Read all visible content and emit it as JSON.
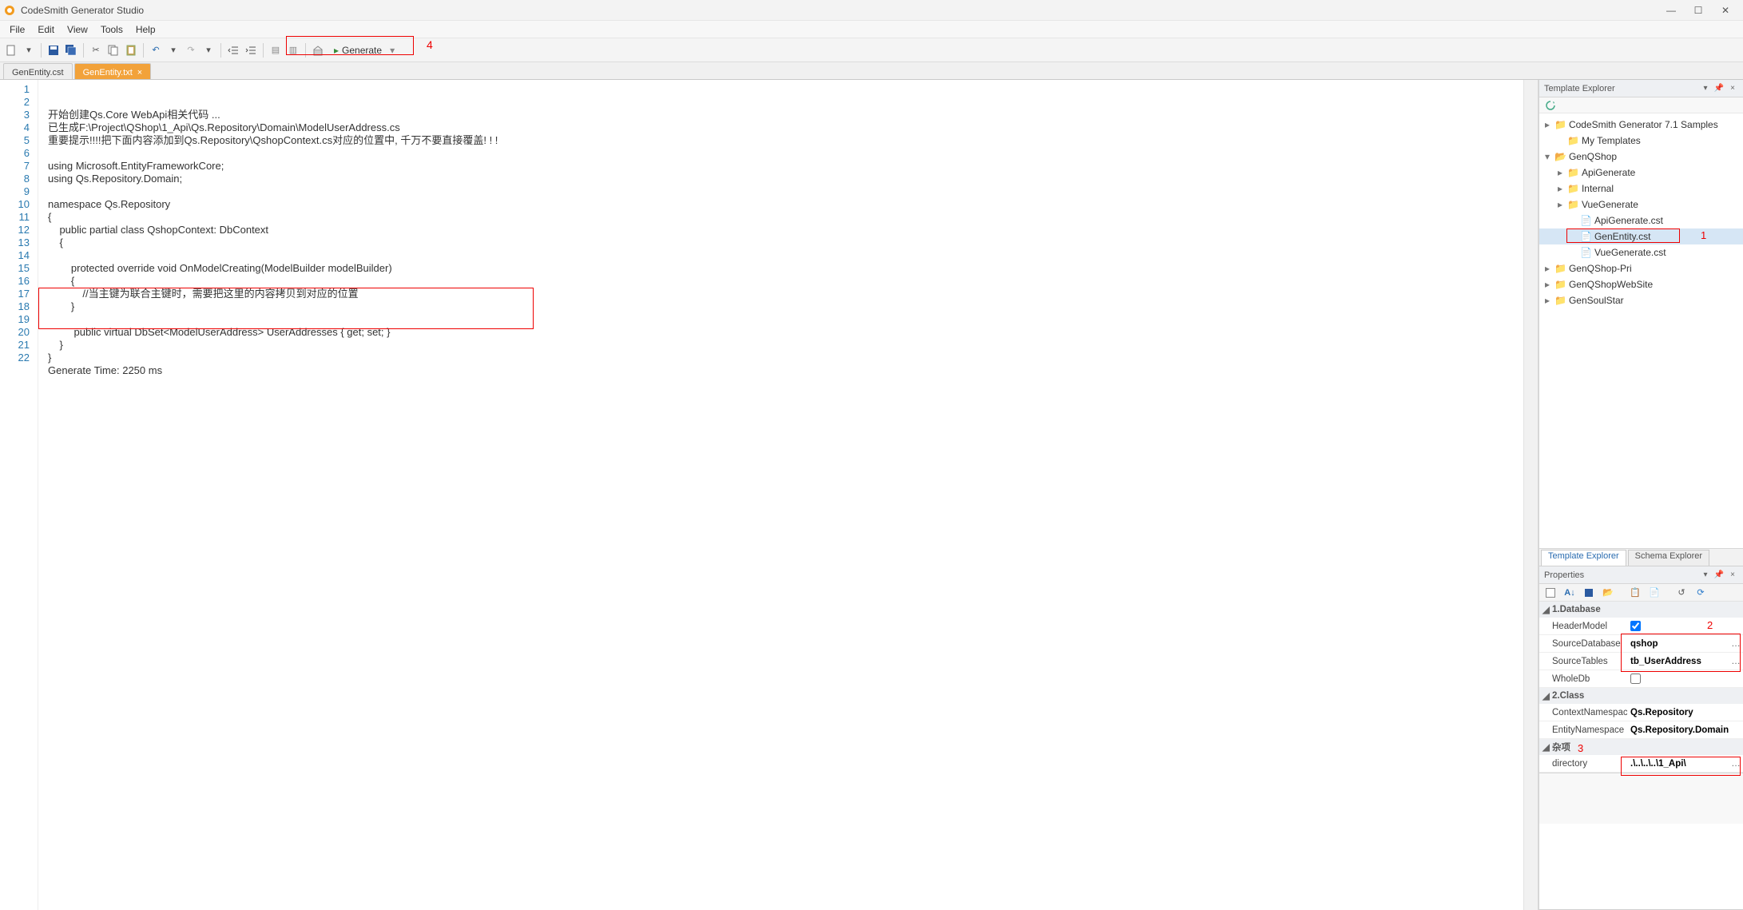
{
  "title": "CodeSmith Generator Studio",
  "menu": {
    "file": "File",
    "edit": "Edit",
    "view": "View",
    "tools": "Tools",
    "help": "Help"
  },
  "toolbar": {
    "generate": "Generate"
  },
  "annotations": {
    "a1": "1",
    "a2": "2",
    "a3": "3",
    "a4": "4"
  },
  "doctabs": {
    "tab1": "GenEntity.cst",
    "tab2": "GenEntity.txt"
  },
  "code": {
    "lineNumbers": [
      "1",
      "2",
      "3",
      "4",
      "5",
      "6",
      "7",
      "8",
      "9",
      "10",
      "11",
      "12",
      "13",
      "14",
      "15",
      "16",
      "17",
      "18",
      "19",
      "20",
      "21",
      "22"
    ],
    "l1": "开始创建Qs.Core WebApi相关代码 ...",
    "l2": "已生成F:\\Project\\QShop\\1_Api\\Qs.Repository\\Domain\\ModelUserAddress.cs",
    "l3": "重要提示!!!!把下面内容添加到Qs.Repository\\QshopContext.cs对应的位置中, 千万不要直接覆盖! ! !",
    "l4": "",
    "l5": "using Microsoft.EntityFrameworkCore;",
    "l6": "using Qs.Repository.Domain;",
    "l7": "",
    "l8": "namespace Qs.Repository",
    "l9": "{",
    "l10": "    public partial class QshopContext: DbContext",
    "l11": "    {",
    "l12": "",
    "l13": "        protected override void OnModelCreating(ModelBuilder modelBuilder)",
    "l14": "        {",
    "l15": "            //当主键为联合主键时，需要把这里的内容拷贝到对应的位置",
    "l16": "        }",
    "l17": "",
    "l18": "         public virtual DbSet<ModelUserAddress> UserAddresses { get; set; }",
    "l19": "    }",
    "l20": "}",
    "l21": "Generate Time: 2250 ms",
    "l22": ""
  },
  "templateExplorer": {
    "title": "Template Explorer",
    "nodes": {
      "root": "CodeSmith Generator 7.1 Samples",
      "myTemplates": "My Templates",
      "genQShop": "GenQShop",
      "apiGenerate": "ApiGenerate",
      "internal": "Internal",
      "vueGenerate": "VueGenerate",
      "apiGenerateCst": "ApiGenerate.cst",
      "genEntityCst": "GenEntity.cst",
      "vueGenerateCst": "VueGenerate.cst",
      "genQShopPri": "GenQShop-Pri",
      "genQShopWebSite": "GenQShopWebSite",
      "genSoulStar": "GenSoulStar"
    },
    "tabs": {
      "template": "Template Explorer",
      "schema": "Schema Explorer"
    }
  },
  "properties": {
    "title": "Properties",
    "sections": {
      "database": "1.Database",
      "klass": "2.Class",
      "misc": "杂项"
    },
    "rows": {
      "headerModel": "HeaderModel",
      "sourceDatabase": "SourceDatabase",
      "sourceTables": "SourceTables",
      "wholeDb": "WholeDb",
      "contextNamespace": "ContextNamespace",
      "entityNamespace": "EntityNamespace",
      "directory": "directory"
    },
    "values": {
      "sourceDatabase": "qshop",
      "sourceTables": "tb_UserAddress",
      "contextNamespace": "Qs.Repository",
      "entityNamespace": "Qs.Repository.Domain",
      "directory": ".\\..\\..\\..\\1_Api\\"
    }
  }
}
